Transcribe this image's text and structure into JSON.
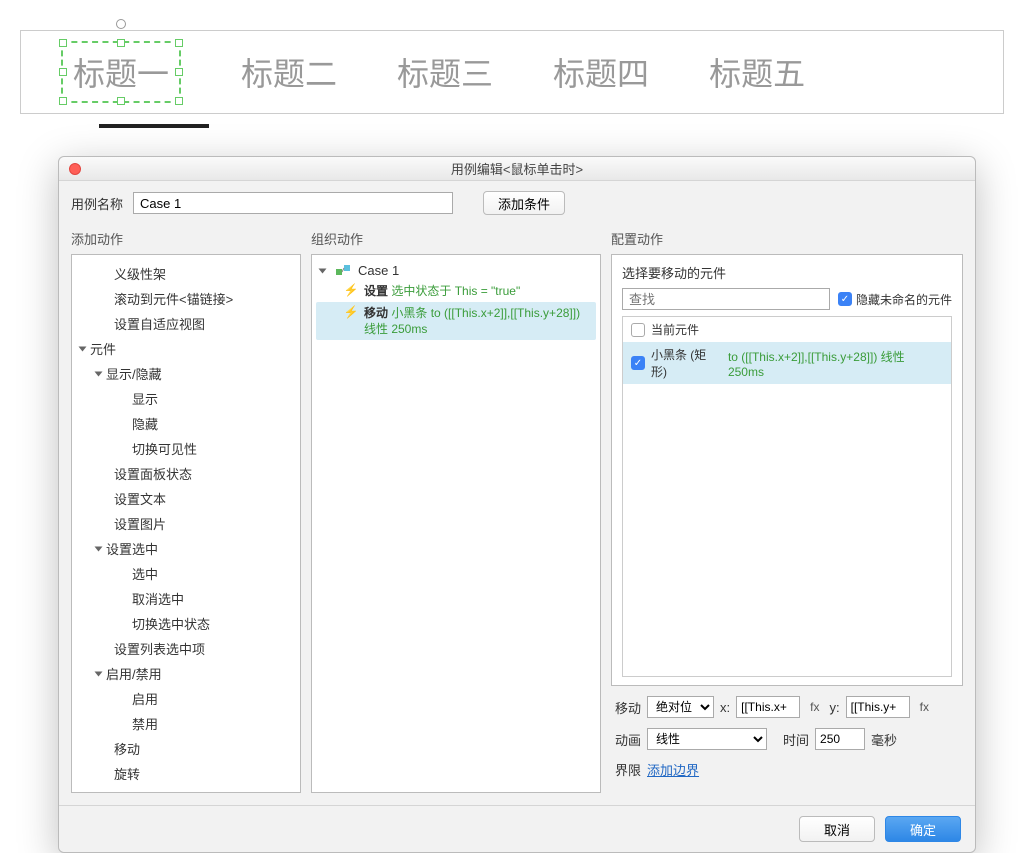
{
  "tabs": [
    "标题一",
    "标题二",
    "标题三",
    "标题四",
    "标题五"
  ],
  "dialog": {
    "title": "用例编辑<鼠标单击时>",
    "caseNameLabel": "用例名称",
    "caseNameValue": "Case 1",
    "addConditionLabel": "添加条件",
    "cols": {
      "left": "添加动作",
      "mid": "组织动作",
      "right": "配置动作"
    },
    "footer": {
      "cancel": "取消",
      "ok": "确定"
    }
  },
  "leftTree": [
    {
      "label": "义级性架",
      "level": 2
    },
    {
      "label": "滚动到元件<锚链接>",
      "level": 2
    },
    {
      "label": "设置自适应视图",
      "level": 2
    },
    {
      "label": "元件",
      "level": 0,
      "open": true
    },
    {
      "label": "显示/隐藏",
      "level": 1,
      "open": true
    },
    {
      "label": "显示",
      "level": 3
    },
    {
      "label": "隐藏",
      "level": 3
    },
    {
      "label": "切换可见性",
      "level": 3
    },
    {
      "label": "设置面板状态",
      "level": 2
    },
    {
      "label": "设置文本",
      "level": 2
    },
    {
      "label": "设置图片",
      "level": 2
    },
    {
      "label": "设置选中",
      "level": 1,
      "open": true
    },
    {
      "label": "选中",
      "level": 3
    },
    {
      "label": "取消选中",
      "level": 3
    },
    {
      "label": "切换选中状态",
      "level": 3
    },
    {
      "label": "设置列表选中项",
      "level": 2
    },
    {
      "label": "启用/禁用",
      "level": 1,
      "open": true
    },
    {
      "label": "启用",
      "level": 3
    },
    {
      "label": "禁用",
      "level": 3
    },
    {
      "label": "移动",
      "level": 2
    },
    {
      "label": "旋转",
      "level": 2
    }
  ],
  "midCase": {
    "name": "Case 1",
    "actions": [
      {
        "verb": "设置",
        "rest": "选中状态于 This = \"true\"",
        "selected": false
      },
      {
        "verb": "移动",
        "rest": "小黑条 to ([[This.x+2]],[[This.y+28]]) 线性 250ms",
        "selected": true
      }
    ]
  },
  "right": {
    "subtitle": "选择要移动的元件",
    "searchPlaceholder": "查找",
    "hideUnnamedLabel": "隐藏未命名的元件",
    "elements": [
      {
        "label": "当前元件",
        "checked": false,
        "extra": ""
      },
      {
        "label": "小黑条 (矩形)",
        "checked": true,
        "extra": "to ([[This.x+2]],[[This.y+28]]) 线性 250ms"
      }
    ],
    "moveLabel": "移动",
    "moveType": "绝对位",
    "xLabel": "x:",
    "xValue": "[[This.x+",
    "yLabel": "y:",
    "yValue": "[[This.y+",
    "fxLabel": "fx",
    "animLabel": "动画",
    "animType": "线性",
    "timeLabel": "时间",
    "timeValue": "250",
    "timeUnit": "毫秒",
    "boundsLabel": "界限",
    "addBoundsLink": "添加边界"
  }
}
